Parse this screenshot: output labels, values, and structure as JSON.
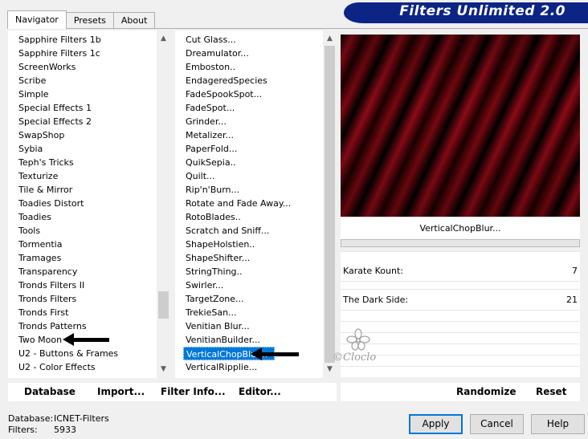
{
  "banner": {
    "title": "Filters Unlimited 2.0"
  },
  "tabs": [
    {
      "label": "Navigator",
      "active": true
    },
    {
      "label": "Presets",
      "active": false
    },
    {
      "label": "About",
      "active": false
    }
  ],
  "categories": {
    "items": [
      "Sapphire Filters 1b",
      "Sapphire Filters 1c",
      "ScreenWorks",
      "Scribe",
      "Simple",
      "Special Effects 1",
      "Special Effects 2",
      "SwapShop",
      "Sybia",
      "Teph's Tricks",
      "Texturize",
      "Tile & Mirror",
      "Toadies Distort",
      "Toadies",
      "Tools",
      "Tormentia",
      "Tramages",
      "Transparency",
      "Tronds Filters II",
      "Tronds Filters",
      "Tronds First",
      "Tronds Patterns",
      "Two Moon",
      "U2 - Buttons & Frames",
      "U2 - Color Effects"
    ]
  },
  "filters": {
    "items": [
      "Cut Glass...",
      "Dreamulator...",
      "Emboston..",
      "EndageredSpecies",
      "FadeSpookSpot...",
      "FadeSpot...",
      "Grinder...",
      "Metalizer...",
      "PaperFold...",
      "QuikSepia..",
      "Quilt...",
      "Rip'n'Burn...",
      "Rotate and Fade Away...",
      "RotoBlades..",
      "Scratch and Sniff...",
      "ShapeHolstien..",
      "ShapeShifter...",
      "StringThing..",
      "Swirler...",
      "TargetZone...",
      "TrekieSan...",
      "Venitian Blur...",
      "VenitianBuilder...",
      "VerticalChopBlur...",
      "VerticalRipplie..."
    ],
    "selected": "VerticalChopBlur..."
  },
  "preview": {
    "filter_name": "VerticalChopBlur..."
  },
  "parameters": [
    {
      "label": "Karate Kount:",
      "value": "7"
    },
    {
      "label": "The Dark Side:",
      "value": "21"
    }
  ],
  "toolbar": {
    "database": "Database",
    "import": "Import...",
    "filter_info": "Filter Info...",
    "editor": "Editor...",
    "randomize": "Randomize",
    "reset": "Reset"
  },
  "status": {
    "database_label": "Database:",
    "database_value": "ICNET-Filters",
    "filters_label": "Filters:",
    "filters_value": "5933"
  },
  "buttons": {
    "apply": "Apply",
    "cancel": "Cancel",
    "help": "Help"
  },
  "watermark": {
    "text": "©Cloclo"
  },
  "colors": {
    "banner": "#0c2585",
    "selection": "#0078d7",
    "preview_dark": "#000000",
    "preview_red": "#8e0a16"
  },
  "icons": [
    "scroll-up-icon",
    "scroll-down-icon",
    "pointer-arrow-icon"
  ]
}
